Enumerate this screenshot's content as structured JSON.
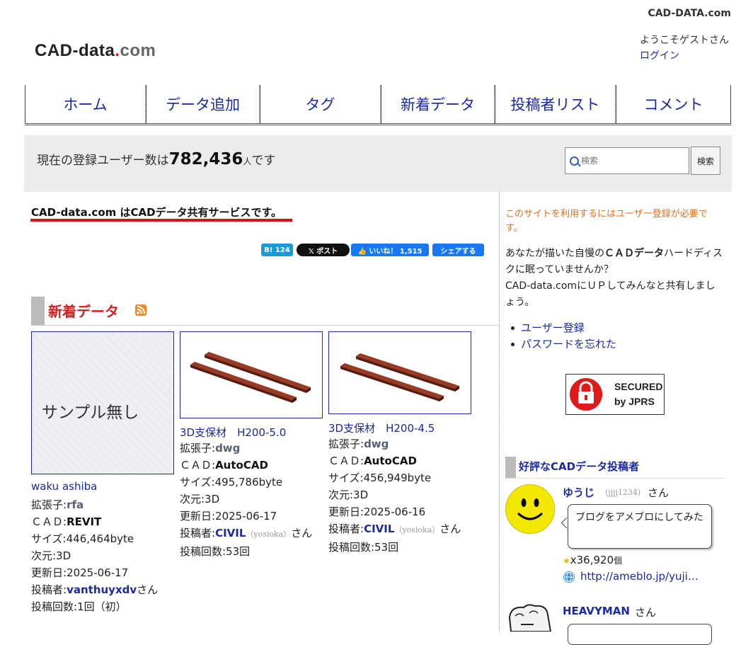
{
  "header": {
    "site_tag": "CAD-DATA.com",
    "logo": {
      "part1": "CAD-data",
      "part2": ".",
      "part3": "com"
    },
    "welcome": "ようこそゲストさん",
    "login": "ログイン"
  },
  "nav": {
    "items": [
      "ホーム",
      "データ追加",
      "タグ",
      "新着データ",
      "投稿者リスト",
      "コメント"
    ]
  },
  "stats": {
    "prefix": "現在の登録ユーザー数は",
    "count": "782,436",
    "unit": "人",
    "suffix": "です"
  },
  "search": {
    "placeholder": "検索",
    "button": "検索"
  },
  "tagline": "CAD-data.com はCADデータ共有サービスです。",
  "social": {
    "hatena": "B! 124",
    "x_post": "𝕏 ポスト",
    "like": "👍 いいね！ 1,515",
    "share": "シェアする"
  },
  "new_data": {
    "heading": "新着データ",
    "cards": [
      {
        "thumb_text": "サンプル無し",
        "title": "waku ashiba",
        "ext_label": "拡張子:",
        "ext": "rfa",
        "cad_label": "ＣＡＤ:",
        "cad": "REVIT",
        "size": "サイズ:446,464byte",
        "dim": "次元:3D",
        "updated": "更新日:2025-06-17",
        "poster_label": "投稿者:",
        "poster": "vanthuyxdv",
        "poster_handle": "",
        "poster_san": "さん",
        "count": "投稿回数:1回（初）"
      },
      {
        "thumb_text": "",
        "title": "3D支保材　H200-5.0",
        "ext_label": "拡張子:",
        "ext": "dwg",
        "cad_label": "ＣＡＤ:",
        "cad": "AutoCAD",
        "size": "サイズ:495,786byte",
        "dim": "次元:3D",
        "updated": "更新日:2025-06-17",
        "poster_label": "投稿者:",
        "poster": "CIVIL",
        "poster_handle": "（yosioka）",
        "poster_san": "さん",
        "count": "投稿回数:53回"
      },
      {
        "thumb_text": "",
        "title": "3D支保材　H200-4.5",
        "ext_label": "拡張子:",
        "ext": "dwg",
        "cad_label": "ＣＡＤ:",
        "cad": "AutoCAD",
        "size": "サイズ:456,949byte",
        "dim": "次元:3D",
        "updated": "更新日:2025-06-16",
        "poster_label": "投稿者:",
        "poster": "CIVIL",
        "poster_handle": "（yosioka）",
        "poster_san": "さん",
        "count": "投稿回数:53回"
      }
    ]
  },
  "sidebar": {
    "reg_note": "このサイトを利用するにはユーザー登録が必要です。",
    "intro_a": "あなたが描いた自慢の",
    "intro_b": "ＣＡＤデータ",
    "intro_c": "ハードディスクに眠っていませんか？",
    "intro_d": "CAD-data.comにＵＰしてみんなと共有しましょう。",
    "links": [
      "ユーザー登録",
      "パスワードを忘れた"
    ],
    "jprs_line1": "SECURED",
    "jprs_line2": "by JPRS",
    "popular_heading": "好評なCADデータ投稿者",
    "users": [
      {
        "name": "ゆうじ",
        "handle": "(jjjj1234)",
        "san": "さん",
        "bubble": "ブログをアメブロにしてみた",
        "points_star": "★",
        "points": "x36,920",
        "points_unit": "個",
        "url": "http://ameblo.jp/yuji…"
      },
      {
        "name": "HEAVYMAN",
        "san": "さん"
      }
    ]
  },
  "colors": {
    "accent_red": "#e01010",
    "link_blue": "#1a2aa0",
    "note_orange": "#e07020"
  }
}
